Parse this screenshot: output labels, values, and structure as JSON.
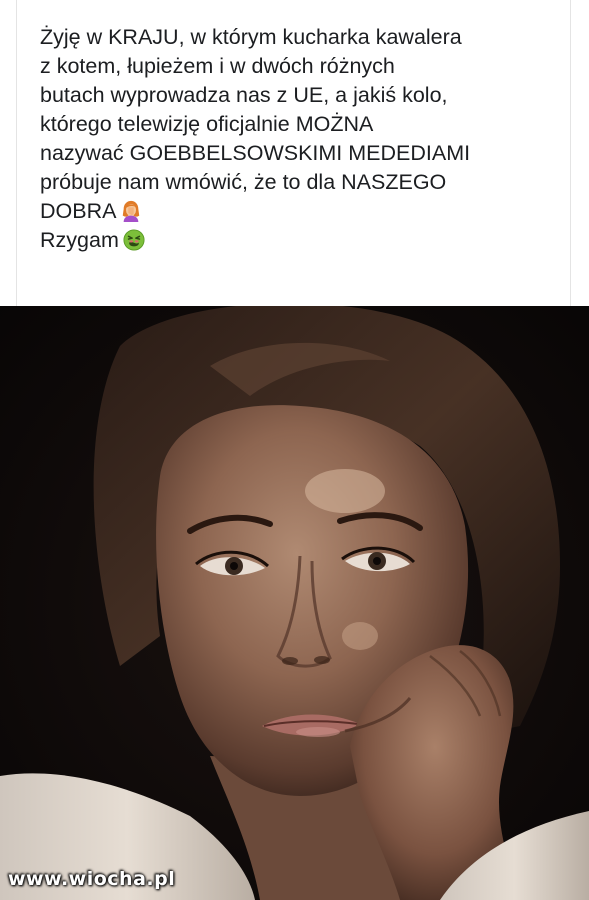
{
  "post": {
    "lines": [
      "Żyję w KRAJU, w którym kucharka kawalera",
      "z kotem, łupieżem i w dwóch różnych",
      "butach wyprowadza nas z UE, a jakiś  kolo,",
      "którego telewizję oficjalnie MOŻNA",
      "nazywać GOEBBELSOWSKIMI MEDEDIAMI",
      "próbuje nam wmówić, że to dla NASZEGO",
      "DOBRA",
      "Rzygam"
    ],
    "emojis": {
      "after_line_7": "woman-facepalming-icon",
      "after_line_8": "nauseated-face-icon"
    }
  },
  "photo": {
    "description_icon": "portrait-photo"
  },
  "watermark": {
    "text": "www.wiocha.pl"
  },
  "colors": {
    "text": "#1c1e21",
    "background": "#ffffff",
    "photo_background": "#0c0807"
  }
}
